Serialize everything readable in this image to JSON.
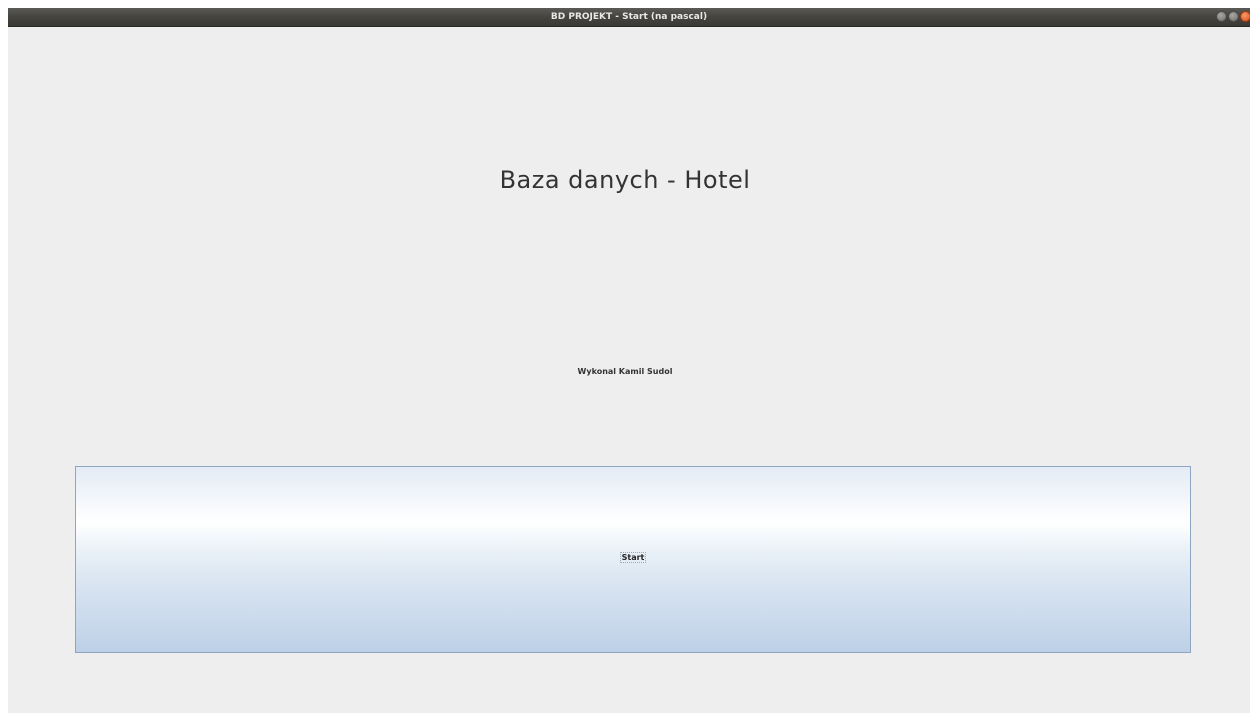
{
  "window": {
    "title": "BD PROJEKT - Start (na pascal)",
    "controls": [
      "minimize-icon",
      "maximize-icon",
      "close-icon"
    ]
  },
  "main": {
    "heading": "Baza danych - Hotel",
    "author": "Wykonal Kamil Sudol",
    "start_button_label": "Start"
  },
  "colors": {
    "background": "#eeeeee",
    "titlebar": "#45443f",
    "button_border": "#8fa6c2",
    "button_gradient_bottom": "#bdd0e6",
    "close_button": "#df4a16"
  }
}
